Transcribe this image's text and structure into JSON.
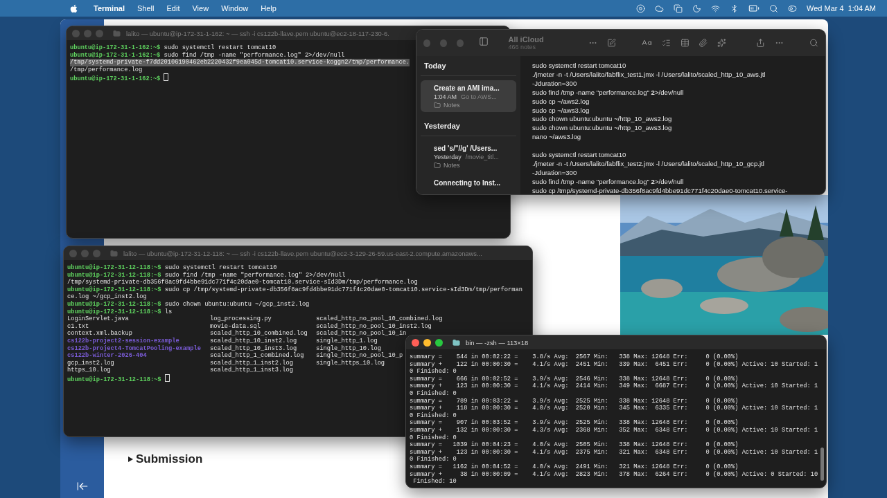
{
  "menu_bar": {
    "app": "Terminal",
    "menus": [
      "Shell",
      "Edit",
      "View",
      "Window",
      "Help"
    ],
    "date": "Wed Mar 4",
    "time": "1:04 AM"
  },
  "browser": {
    "heading": "Submission",
    "expanded": false
  },
  "terminals": [
    {
      "title": "lalito — ubuntu@ip-172-31-1-162: ~ — ssh -i cs122b-llave.pem ubuntu@ec2-18-117-230-6.",
      "active": false,
      "lines": [
        {
          "kind": "prompt",
          "prompt": "ubuntu@ip-172-31-1-162:~$",
          "command": "sudo systemctl restart tomcat10"
        },
        {
          "kind": "prompt",
          "prompt": "ubuntu@ip-172-31-1-162:~$",
          "command": "sudo find /tmp -name \"performance.log\" 2>/dev/null"
        },
        {
          "kind": "output",
          "text": "/tmp/systemd-private-f7dd20106190462eb2220432f9ea045d-tomcat10.service-koggn2/tmp/performance.",
          "selected": true
        },
        {
          "kind": "output",
          "text": "/tmp/performance.log",
          "selected": false
        },
        {
          "kind": "prompt",
          "prompt": "ubuntu@ip-172-31-1-162:~$",
          "cursor": true
        }
      ]
    },
    {
      "title": "lalito — ubuntu@ip-172-31-12-118: ~ — ssh -i cs122b-llave.pem ubuntu@ec2-3-129-26-59.us-east-2.compute.amazonaws...",
      "active": false,
      "lines": [
        {
          "kind": "prompt",
          "prompt": "ubuntu@ip-172-31-12-118:~$",
          "command": "sudo systemctl restart tomcat10"
        },
        {
          "kind": "prompt",
          "prompt": "ubuntu@ip-172-31-12-118:~$",
          "command": "sudo find /tmp -name \"performance.log\" 2>/dev/null"
        },
        {
          "kind": "output",
          "text": "/tmp/systemd-private-db356f8ac9fd4bbe91dc771f4c20dae0-tomcat10.service-sId3Dm/tmp/performance.log",
          "selected": false
        },
        {
          "kind": "prompt",
          "prompt": "ubuntu@ip-172-31-12-118:~$",
          "command": "sudo cp /tmp/systemd-private-db356f8ac9fd4bbe91dc771f4c20dae0-tomcat10.service-sId3Dm/tmp/performan"
        },
        {
          "kind": "output",
          "text": "ce.log ~/gcp_inst2.log",
          "selected": false
        },
        {
          "kind": "prompt",
          "prompt": "ubuntu@ip-172-31-12-118:~$",
          "command": "sudo chown ubuntu:ubuntu ~/gcp_inst2.log"
        },
        {
          "kind": "prompt",
          "prompt": "ubuntu@ip-172-31-12-118:~$",
          "command": "ls"
        },
        {
          "kind": "listing",
          "columns": [
            [
              {
                "name": "LoginServlet.java",
                "kind": "file"
              },
              {
                "name": "c1.txt",
                "kind": "file"
              },
              {
                "name": "context.xml.backup",
                "kind": "file"
              },
              {
                "name": "cs122b-project2-session-example",
                "kind": "directory"
              },
              {
                "name": "cs122b-project4-TomcatPooling-example",
                "kind": "directory"
              },
              {
                "name": "cs122b-winter-2026-404",
                "kind": "directory"
              },
              {
                "name": "gcp_inst2.log",
                "kind": "file"
              },
              {
                "name": "https_10.log",
                "kind": "file"
              }
            ],
            [
              {
                "name": "log_processing.py",
                "kind": "file"
              },
              {
                "name": "movie-data.sql",
                "kind": "file"
              },
              {
                "name": "scaled_http_10_combined.log",
                "kind": "file"
              },
              {
                "name": "scaled_http_10_inst2.log",
                "kind": "file"
              },
              {
                "name": "scaled_http_10_inst3.log",
                "kind": "file"
              },
              {
                "name": "scaled_http_1_combined.log",
                "kind": "file"
              },
              {
                "name": "scaled_http_1_inst2.log",
                "kind": "file"
              },
              {
                "name": "scaled_http_1_inst3.log",
                "kind": "file"
              }
            ],
            [
              {
                "name": "scaled_http_no_pool_10_combined.log",
                "kind": "file"
              },
              {
                "name": "scaled_http_no_pool_10_inst2.log",
                "kind": "file"
              },
              {
                "name": "scaled_http_no_pool_10_in",
                "kind": "file"
              },
              {
                "name": "single_http_1.log",
                "kind": "file"
              },
              {
                "name": "single_http_10.log",
                "kind": "file"
              },
              {
                "name": "single_http_no_pool_10_p",
                "kind": "file"
              },
              {
                "name": "single_https_10.log",
                "kind": "file"
              }
            ]
          ]
        },
        {
          "kind": "prompt",
          "prompt": "ubuntu@ip-172-31-12-118:~$",
          "cursor": true
        }
      ]
    },
    {
      "title": "bin — -zsh — 113×18",
      "active": true,
      "lines": [
        {
          "kind": "output",
          "text": "summary =    544 in 00:02:22 =    3.8/s Avg:  2567 Min:   338 Max: 12648 Err:     0 (0.00%)",
          "selected": false
        },
        {
          "kind": "output",
          "text": "summary +    122 in 00:00:30 =    4.1/s Avg:  2451 Min:   339 Max:  6451 Err:     0 (0.00%) Active: 10 Started: 1",
          "selected": false
        },
        {
          "kind": "output",
          "text": "0 Finished: 0",
          "selected": false
        },
        {
          "kind": "output",
          "text": "summary =    666 in 00:02:52 =    3.9/s Avg:  2546 Min:   338 Max: 12648 Err:     0 (0.00%)",
          "selected": false
        },
        {
          "kind": "output",
          "text": "summary +    123 in 00:00:30 =    4.1/s Avg:  2414 Min:   349 Max:  6687 Err:     0 (0.00%) Active: 10 Started: 1",
          "selected": false
        },
        {
          "kind": "output",
          "text": "0 Finished: 0",
          "selected": false
        },
        {
          "kind": "output",
          "text": "summary =    789 in 00:03:22 =    3.9/s Avg:  2525 Min:   338 Max: 12648 Err:     0 (0.00%)",
          "selected": false
        },
        {
          "kind": "output",
          "text": "summary +    118 in 00:00:30 =    4.0/s Avg:  2520 Min:   345 Max:  6335 Err:     0 (0.00%) Active: 10 Started: 1",
          "selected": false
        },
        {
          "kind": "output",
          "text": "0 Finished: 0",
          "selected": false
        },
        {
          "kind": "output",
          "text": "summary =    907 in 00:03:52 =    3.9/s Avg:  2525 Min:   338 Max: 12648 Err:     0 (0.00%)",
          "selected": false
        },
        {
          "kind": "output",
          "text": "summary +    132 in 00:00:30 =    4.3/s Avg:  2368 Min:   352 Max:  6348 Err:     0 (0.00%) Active: 10 Started: 1",
          "selected": false
        },
        {
          "kind": "output",
          "text": "0 Finished: 0",
          "selected": false
        },
        {
          "kind": "output",
          "text": "summary =   1039 in 00:04:23 =    4.0/s Avg:  2505 Min:   338 Max: 12648 Err:     0 (0.00%)",
          "selected": false
        },
        {
          "kind": "output",
          "text": "summary +    123 in 00:00:30 =    4.1/s Avg:  2375 Min:   321 Max:  6348 Err:     0 (0.00%) Active: 10 Started: 1",
          "selected": false
        },
        {
          "kind": "output",
          "text": "0 Finished: 0",
          "selected": false
        },
        {
          "kind": "output",
          "text": "summary =   1162 in 00:04:52 =    4.0/s Avg:  2491 Min:   321 Max: 12648 Err:     0 (0.00%)",
          "selected": false
        },
        {
          "kind": "output",
          "text": "summary +     38 in 00:00:09 =    4.1/s Avg:  2823 Min:   378 Max:  6264 Err:     0 (0.00%) Active: 0 Started: 10",
          "selected": false
        },
        {
          "kind": "output",
          "text": " Finished: 10",
          "selected": false
        }
      ]
    }
  ],
  "notes": {
    "title": "All iCloud",
    "count": "466 notes",
    "sections": [
      {
        "heading": "Today",
        "notes": [
          {
            "title": "Create an AMI ima...",
            "date": "1:04 AM",
            "preview": "Go to AWS...",
            "folder": "Notes",
            "selected": true
          }
        ]
      },
      {
        "heading": "Yesterday",
        "notes": [
          {
            "title": "sed 's/\"//g' /Users...",
            "date": "Yesterday",
            "preview": "/movie_titl...",
            "folder": "Notes",
            "selected": false
          },
          {
            "title": "Connecting to Inst...",
            "selected": false
          }
        ]
      }
    ],
    "body": [
      [
        "sudo systemctl restart tomcat10",
        "./jmeter -n -t /Users/lalito/fabflix_test1.jmx -l /Users/lalito/scaled_http_10_aws.jtl",
        "-Jduration=300",
        "sudo find /tmp -name \"performance.log\" **2**>/dev/null",
        "sudo cp ~/aws2.log",
        "sudo cp ~/aws3.log",
        "sudo chown ubuntu:ubuntu ~/http_10_aws2.log",
        "sudo chown ubuntu:ubuntu ~/http_10_aws3.log",
        "nano ~/aws3.log"
      ],
      [
        "sudo systemctl restart tomcat10",
        "./jmeter -n -t /Users/lalito/fabflix_test2.jmx -l /Users/lalito/scaled_http_10_gcp.jtl",
        "-Jduration=300",
        "sudo find /tmp -name \"performance.log\" **2**>/dev/null",
        "sudo cp /tmp/systemd-private-db356f8ac9fd4bbe91dc771f4c20dae0-tomcat10.service-"
      ]
    ]
  }
}
